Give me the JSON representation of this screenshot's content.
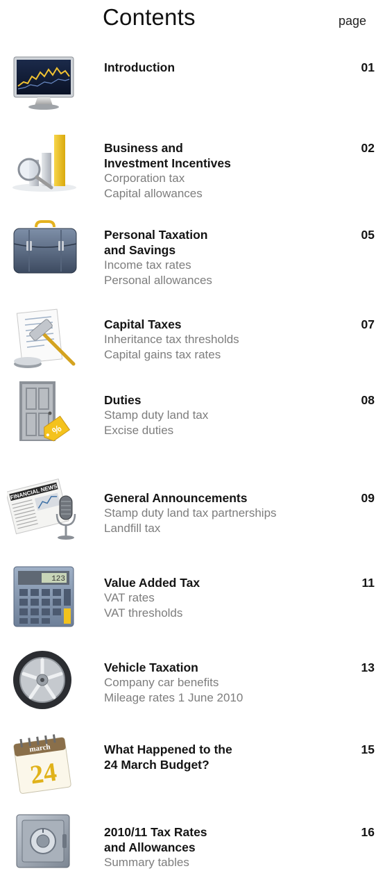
{
  "header": {
    "title": "Contents",
    "page_label": "page"
  },
  "entries": [
    {
      "icon": "monitor-chart-icon",
      "heading": "Introduction",
      "subs": [],
      "page": "01"
    },
    {
      "icon": "bar-chart-magnifier-icon",
      "heading": "Business and\nInvestment Incentives",
      "subs": [
        "Corporation tax",
        "Capital allowances"
      ],
      "page": "02"
    },
    {
      "icon": "briefcase-icon",
      "heading": "Personal Taxation\nand Savings",
      "subs": [
        "Income tax rates",
        "Personal allowances"
      ],
      "page": "05"
    },
    {
      "icon": "document-gavel-icon",
      "heading": "Capital Taxes",
      "subs": [
        "Inheritance tax thresholds",
        "Capital gains tax rates"
      ],
      "page": "07"
    },
    {
      "icon": "door-tag-icon",
      "heading": "Duties",
      "subs": [
        "Stamp duty land tax",
        "Excise duties"
      ],
      "page": "08"
    },
    {
      "icon": "newspaper-microphone-icon",
      "heading": "General Announcements",
      "subs": [
        "Stamp duty land tax partnerships",
        "Landfill tax"
      ],
      "page": "09"
    },
    {
      "icon": "calculator-icon",
      "heading": "Value Added Tax",
      "subs": [
        "VAT rates",
        "VAT thresholds"
      ],
      "page": "11"
    },
    {
      "icon": "car-wheel-icon",
      "heading": "Vehicle Taxation",
      "subs": [
        "Company car benefits",
        "Mileage rates 1 June 2010"
      ],
      "page": "13"
    },
    {
      "icon": "calendar-icon",
      "heading": "What Happened to the\n24 March Budget?",
      "subs": [],
      "page": "15"
    },
    {
      "icon": "safe-icon",
      "heading": "2010/11 Tax Rates\nand Allowances",
      "subs": [
        "Summary tables"
      ],
      "page": "16"
    }
  ],
  "icon_text": {
    "newspaper_masthead": "FINANCIAL NEWS",
    "calculator_display": "123",
    "calendar_month": "march",
    "calendar_day": "24",
    "tag_symbol": "%"
  }
}
